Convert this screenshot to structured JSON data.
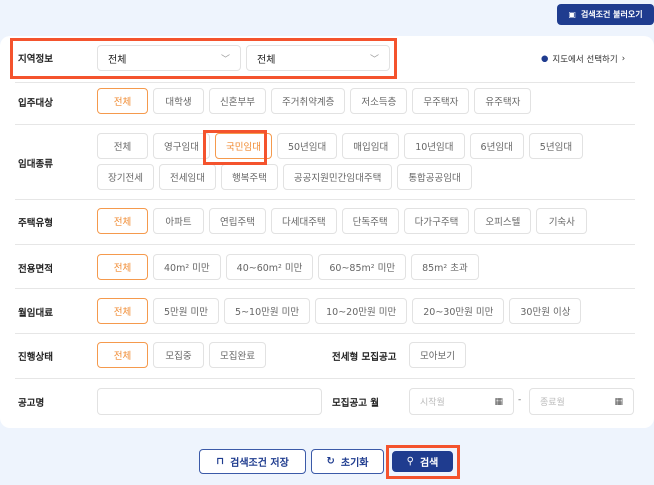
{
  "header": {
    "load_button": "검색조건 불러오기",
    "load_icon": "calendar-download-icon"
  },
  "region": {
    "label": "지역정보",
    "select1": "전체",
    "select2": "전체",
    "map_link": "지도에서 선택하기",
    "map_icon": "map-pin-icon"
  },
  "filters": [
    {
      "label": "입주대상",
      "options": [
        "전체",
        "대학생",
        "신혼부부",
        "주거취약계층",
        "저소득층",
        "무주택자",
        "유주택자"
      ],
      "selected": "전체"
    },
    {
      "label": "임대종류",
      "options": [
        "전체",
        "영구임대",
        "국민임대",
        "50년임대",
        "매입임대",
        "10년임대",
        "6년임대",
        "5년임대",
        "장기전세",
        "전세임대",
        "행복주택",
        "공공지원민간임대주택",
        "통합공공임대"
      ],
      "selected": "국민임대"
    },
    {
      "label": "주택유형",
      "options": [
        "전체",
        "아파트",
        "연립주택",
        "다세대주택",
        "단독주택",
        "다가구주택",
        "오피스텔",
        "기숙사"
      ],
      "selected": "전체"
    },
    {
      "label": "전용면적",
      "options": [
        "전체",
        "40m² 미만",
        "40~60m² 미만",
        "60~85m² 미만",
        "85m² 초과"
      ],
      "selected": "전체"
    },
    {
      "label": "월임대료",
      "options": [
        "전체",
        "5만원 미만",
        "5~10만원 미만",
        "10~20만원 미만",
        "20~30만원 미만",
        "30만원 이상"
      ],
      "selected": "전체"
    }
  ],
  "status": {
    "label": "진행상태",
    "options": [
      "전체",
      "모집중",
      "모집완료"
    ],
    "selected": "전체",
    "jeonse_label": "전세형 모집공고",
    "jeonse_button": "모아보기"
  },
  "notice": {
    "label": "공고명",
    "value": "",
    "month_label": "모집공고 월",
    "start_placeholder": "시작월",
    "end_placeholder": "종료월",
    "separator": "-"
  },
  "actions": {
    "save": "검색조건 저장",
    "reset": "초기화",
    "search": "검색"
  },
  "colors": {
    "accent": "#f08a30",
    "primary": "#1f3c8f",
    "highlight": "#f4532d"
  }
}
